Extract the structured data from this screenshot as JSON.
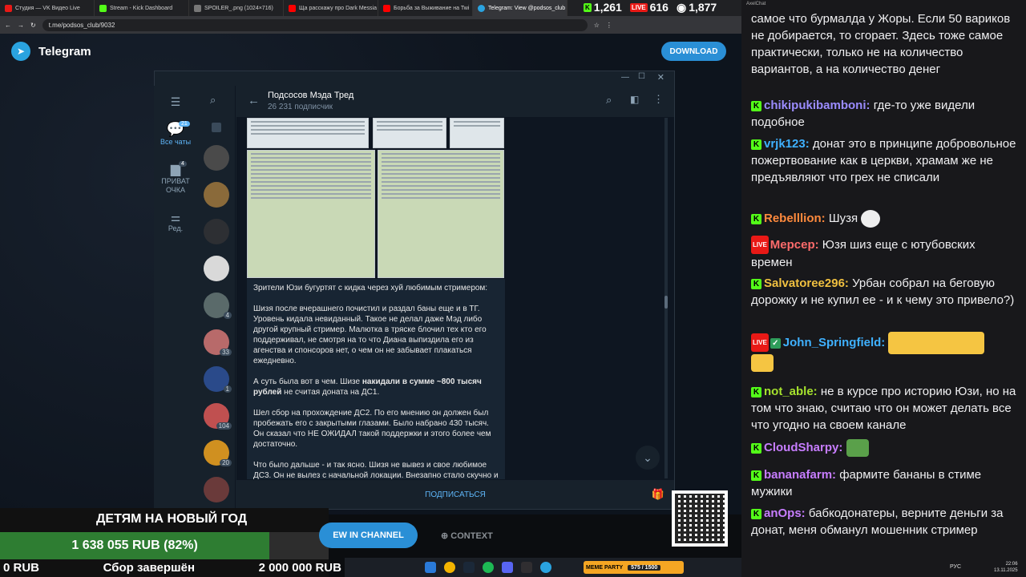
{
  "browser": {
    "tabs": [
      {
        "label": "Студия — VK Видео Live",
        "color": "#e91916"
      },
      {
        "label": "Stream - Kick Dashboard",
        "color": "#53fc18"
      },
      {
        "label": "SPOILER_.png (1024×716)",
        "color": "#777777"
      },
      {
        "label": "Ща расскажу про Dark Messia",
        "color": "#ff0000"
      },
      {
        "label": "Борьба за Выживание на Twi",
        "color": "#ff0000"
      },
      {
        "label": "Telegram: View @podsos_club",
        "color": "#2aa3e0"
      }
    ],
    "url": "t.me/podsos_club/9032"
  },
  "stats": {
    "kick": "1,261",
    "vk": "616",
    "views": "1,877",
    "vk_badge": "LIVE"
  },
  "telegram": {
    "brand": "Telegram",
    "download": "DOWNLOAD",
    "rail": {
      "all_chats": "Все чаты",
      "all_count": "21",
      "private": "ПРИВАТ ОЧКА",
      "private_count": "4",
      "edit": "Ред."
    },
    "chat_counts": [
      "4",
      "33",
      "1",
      "104",
      "20"
    ],
    "channel_title": "Подсосов Мэда Тред",
    "subscribers": "26 231 подписчик",
    "post": {
      "p1": "Зрители Юзи бугуртят с кидка через хуй любимым стримером:",
      "p2": "Шизя после вчерашнего почистил и раздал баны еще и в ТГ. Уровень кидала невиданный. Такое не делал даже Мэд либо другой крупный стример. Малютка в тряске блочил тех кто его поддерживал, не смотря на то что Диана выпиздила его из агенства и спонсоров нет, о чем он не забывает плакаться ежедневно.",
      "p3a": "А суть была вот в чем. Шизе ",
      "p3b": "накидали в сумме ~800 тысяч рублей",
      "p3c": " не считая доната на ДС1.",
      "p4": "Шел сбор на прохождение ДС2. По его мнению он должен был пробежать его с закрытыми глазами. Было набрано 430 тысяч. Он сказал что НЕ ОЖИДАЛ такой поддержки и этого более чем достаточно.",
      "p5": "Что было дальше - и так ясно. Шизя не вывез и свое любимое ДС3. Он не вылез с начальной локации. Внезапно стало скучно и вновь ДРОП."
    },
    "subscribe": "ПОДПИСАТЬСЯ",
    "view_in_channel": "EW IN CHANNEL",
    "context": "CONTEXT"
  },
  "chat": {
    "header": "AxelChat",
    "messages": [
      {
        "user": "",
        "color": "#efeff1",
        "text": "самое что бурмалда у Жоры. Если 50 вариков не добирается, то сгорает. Здесь тоже самое практически, только не на количество вариантов, а на количество денег"
      },
      {
        "user": "chikipukibamboni:",
        "color": "#9b8cff",
        "text": "где-то уже видели подобное"
      },
      {
        "user": "vrjk123:",
        "color": "#3fb1ff",
        "text": "донат это в принципе добровольное пожертвование как в церкви, храмам же не предъявляют что грех не списали"
      },
      {
        "user": "Rebelllion:",
        "color": "#ff8a3d",
        "text": "Шузя"
      },
      {
        "user": "Мерсер:",
        "color": "#ff6b6b",
        "text": "Юзя шиз еще с ютубовских времен"
      },
      {
        "user": "Salvatoree296:",
        "color": "#f0c040",
        "text": "Урбан собрал на беговую дорожку и не купил ее - и к чему это привело?)"
      },
      {
        "user": "John_Springfield:",
        "color": "#3fb1ff",
        "text": ""
      },
      {
        "user": "not_able:",
        "color": "#a6e22e",
        "text": "не в курсе про историю Юзи, но на том что знаю, считаю что он может делать все что угодно на своем канале"
      },
      {
        "user": "CloudSharpy:",
        "color": "#c77dff",
        "text": ""
      },
      {
        "user": "bananafarm:",
        "color": "#c77dff",
        "text": "фармите бананы в стиме мужики"
      },
      {
        "user": "anOps:",
        "color": "#c77dff",
        "text": "бабкодонатеры, верните деньги за донат, меня обманул мошенник стример"
      }
    ]
  },
  "goal": {
    "title": "ДЕТЯМ НА НОВЫЙ ГОД",
    "progress_text": "1 638 055 RUB (82%)",
    "progress_fraction": 0.82,
    "left": "0 RUB",
    "status": "Сбор завершён",
    "target": "2 000 000 RUB"
  },
  "taskbar": {
    "lang": "РУС",
    "time": "22:06",
    "date": "13.11.2025",
    "party": "MEME PARTY",
    "party_count": "575 / 1500"
  }
}
